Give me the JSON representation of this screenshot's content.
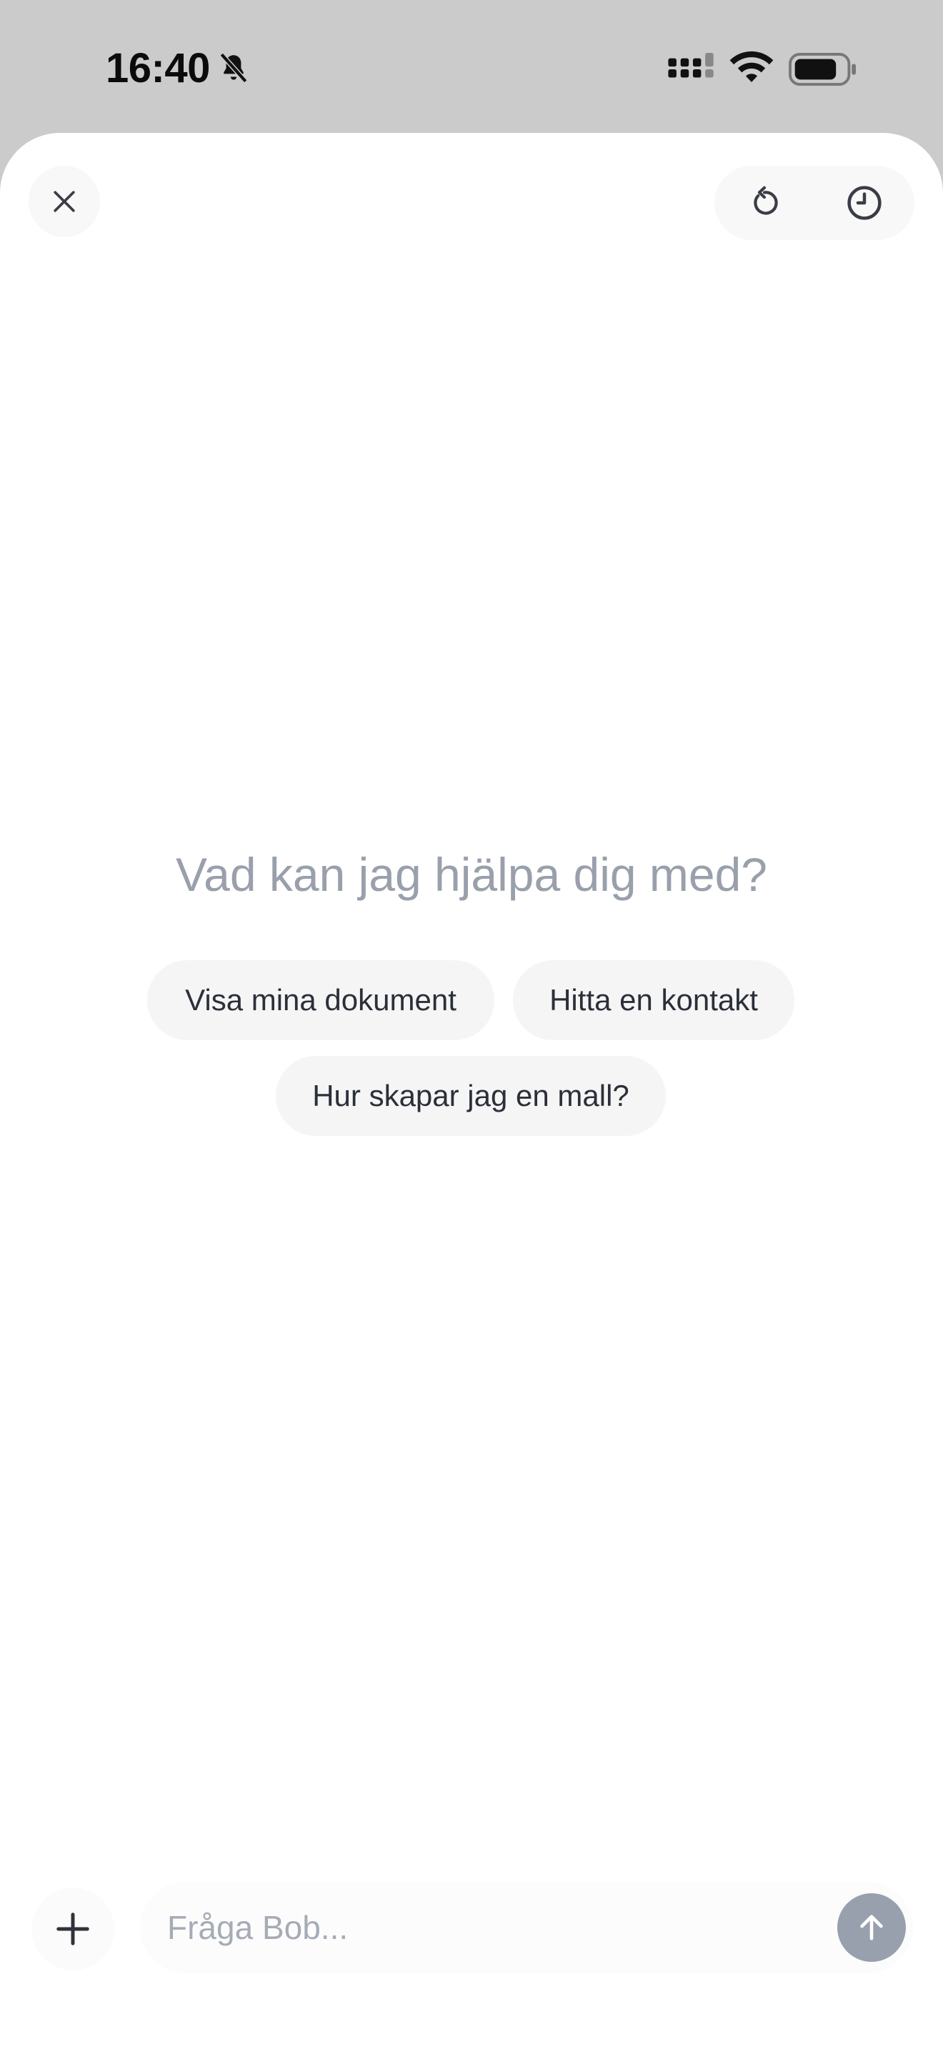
{
  "status_bar": {
    "time": "16:40",
    "icons": [
      "bell-slash-icon",
      "cellular-signal-icon",
      "wifi-icon",
      "battery-icon"
    ]
  },
  "header": {
    "close_icon": "close-icon",
    "reset_icon": "reset-icon",
    "history_icon": "history-clock-icon"
  },
  "main": {
    "headline": "Vad kan jag hjälpa dig med?",
    "suggestions": [
      "Visa mina dokument",
      "Hitta en kontakt",
      "Hur skapar jag en mall?"
    ]
  },
  "composer": {
    "add_icon": "plus-icon",
    "input_value": "",
    "placeholder": "Fråga Bob...",
    "send_icon": "arrow-up-icon"
  },
  "colors": {
    "status_bar_bg": "#cbcbcb",
    "sheet_bg": "#ffffff",
    "headline": "#99a0ac",
    "chip_bg": "#f5f5f6",
    "chip_text": "#2b2f38",
    "send_button": "#98a0ad"
  }
}
